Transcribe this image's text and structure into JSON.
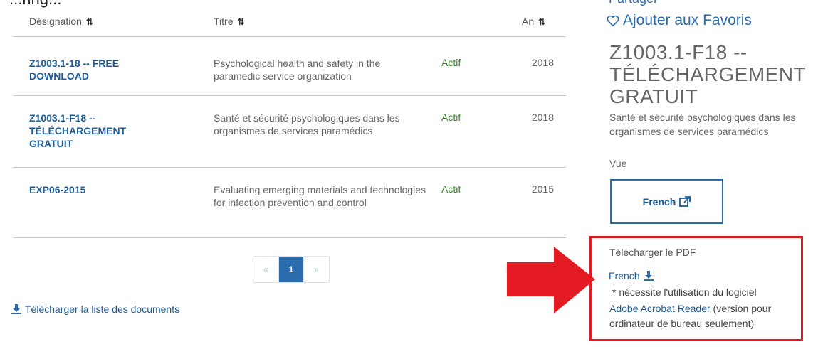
{
  "top_caption": "...ring...",
  "table": {
    "headers": {
      "designation": "Désignation",
      "titre": "Titre",
      "an": "An"
    },
    "sort_glyph": "⇅",
    "rows": [
      {
        "code": "Z1003.1-18 -- FREE DOWNLOAD",
        "title": "Psychological health and safety in the paramedic service organization",
        "status": "Actif",
        "year": "2018"
      },
      {
        "code": "Z1003.1-F18 -- TÉLÉCHARGEMENT GRATUIT",
        "title": "Santé et sécurité psychologiques dans les organismes de services paramédics",
        "status": "Actif",
        "year": "2018"
      },
      {
        "code": "EXP06-2015",
        "title": "Evaluating emerging materials and technologies for infection prevention and control",
        "status": "Actif",
        "year": "2015"
      }
    ]
  },
  "pagination": {
    "prev": "«",
    "current": "1",
    "next": "»"
  },
  "download_list": "Télécharger la liste des documents",
  "panel": {
    "share": "Partager",
    "favorites": "Ajouter aux Favoris",
    "title": "Z1003.1-F18 -- TÉLÉCHARGEMENT GRATUIT",
    "description": "Santé et sécurité psychologiques dans les organismes de services paramédics",
    "vue_label": "Vue",
    "view_button": "French",
    "pdf_label": "Télécharger le PDF",
    "pdf_link": "French",
    "note_line1": "* nécessite l'utilisation du logiciel",
    "note_link": "Adobe Acrobat Reader",
    "note_rest": "(version pour ordinateur de bureau seulement)"
  },
  "colors": {
    "link": "#1d5c96",
    "accent": "#2a6cae",
    "status": "#3a8a2a",
    "highlight": "#e41a22"
  }
}
